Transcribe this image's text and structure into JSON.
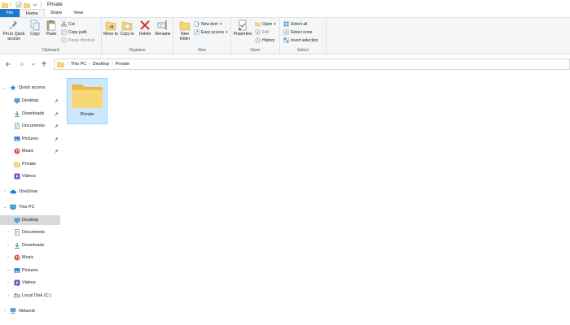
{
  "window": {
    "title": "Private"
  },
  "tabs": [
    {
      "label": "File"
    },
    {
      "label": "Home"
    },
    {
      "label": "Share"
    },
    {
      "label": "View"
    }
  ],
  "ribbon": {
    "clipboard": {
      "label": "Clipboard",
      "pin_label": "Pin to Quick access",
      "copy_label": "Copy",
      "paste_label": "Paste",
      "cut_label": "Cut",
      "copy_path_label": "Copy path",
      "paste_shortcut_label": "Paste shortcut"
    },
    "organize": {
      "label": "Organize",
      "move_to_label": "Move to",
      "copy_to_label": "Copy to",
      "delete_label": "Delete",
      "rename_label": "Rename"
    },
    "new": {
      "label": "New",
      "new_folder_label": "New folder",
      "new_item_label": "New item",
      "easy_access_label": "Easy access"
    },
    "open": {
      "label": "Open",
      "properties_label": "Properties",
      "open_label": "Open",
      "edit_label": "Edit",
      "history_label": "History"
    },
    "select": {
      "label": "Select",
      "select_all_label": "Select all",
      "select_none_label": "Select none",
      "invert_label": "Invert selection"
    }
  },
  "breadcrumb": [
    "This PC",
    "Desktop",
    "Private"
  ],
  "nav": {
    "quick_access": "Quick access",
    "quick_items": [
      "Desktop",
      "Downloads",
      "Documents",
      "Pictures",
      "Music",
      "Private",
      "Videos"
    ],
    "onedrive": "OneDrive",
    "this_pc": "This PC",
    "pc_items": [
      "Desktop",
      "Documents",
      "Downloads",
      "Music",
      "Pictures",
      "Videos",
      "Local Disk (C:)"
    ],
    "network": "Network"
  },
  "content": {
    "folder_name": "Private"
  },
  "colors": {
    "accent": "#1979ca",
    "folder": "#f8d775",
    "selection": "#cce8ff"
  }
}
